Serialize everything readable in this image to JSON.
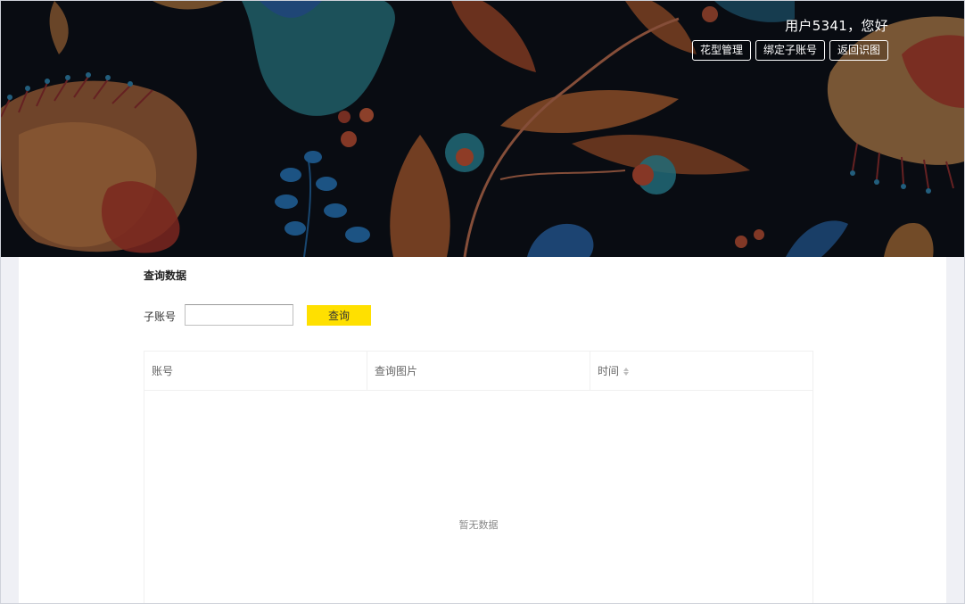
{
  "header": {
    "greeting": "用户5341，您好",
    "buttons": [
      {
        "label": "花型管理"
      },
      {
        "label": "绑定子账号"
      },
      {
        "label": "返回识图"
      }
    ]
  },
  "main": {
    "section_title": "查询数据",
    "filter": {
      "label": "子账号",
      "value": "",
      "button_label": "查询"
    },
    "table": {
      "columns": [
        "账号",
        "查询图片",
        "时间"
      ],
      "sortable_column": "时间",
      "empty_text": "暂无数据",
      "rows": []
    }
  },
  "colors": {
    "accent": "#ffe000",
    "banner_bg": "#0b0d14",
    "page_bg": "#eff0f5"
  }
}
